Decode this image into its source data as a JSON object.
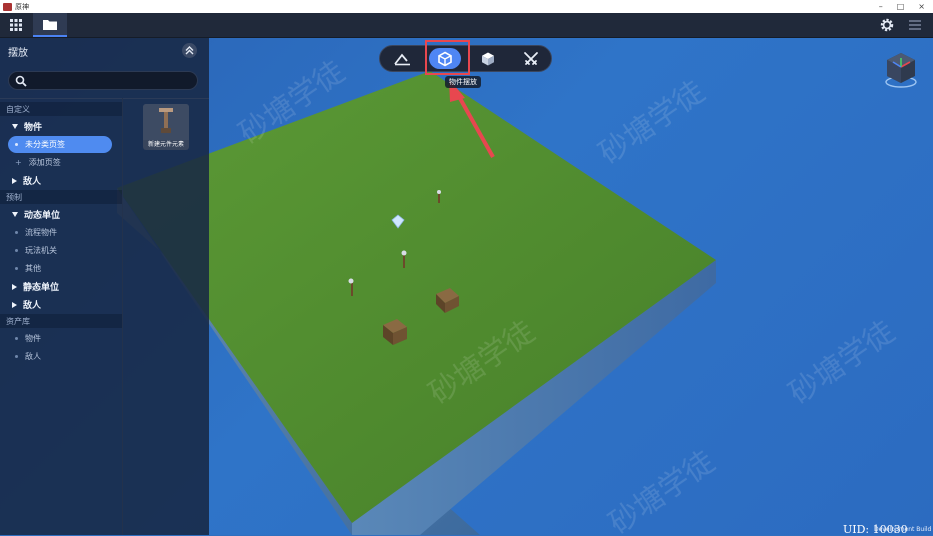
{
  "window": {
    "title": "原神",
    "minimize": "–",
    "maximize": "□",
    "close": "×"
  },
  "toolbar": {
    "grid_icon": "grid-icon",
    "folder_icon": "folder-icon",
    "settings_icon": "gear-icon",
    "menu_icon": "menu-icon"
  },
  "panel": {
    "title": "摆放",
    "search_placeholder": "",
    "tree": [
      {
        "kind": "section",
        "label": "自定义"
      },
      {
        "kind": "group",
        "label": "物件",
        "expanded": true
      },
      {
        "kind": "leaf",
        "label": "未分类页签",
        "active": true
      },
      {
        "kind": "add",
        "label": "添加页签"
      },
      {
        "kind": "group",
        "label": "敌人",
        "expanded": false
      },
      {
        "kind": "section",
        "label": "预制"
      },
      {
        "kind": "group",
        "label": "动态单位",
        "expanded": true
      },
      {
        "kind": "leaf",
        "label": "流程物件"
      },
      {
        "kind": "leaf",
        "label": "玩法机关"
      },
      {
        "kind": "leaf",
        "label": "其他"
      },
      {
        "kind": "group",
        "label": "静态单位",
        "expanded": false
      },
      {
        "kind": "group",
        "label": "敌人",
        "expanded": false
      },
      {
        "kind": "section",
        "label": "资产库"
      },
      {
        "kind": "leaf",
        "label": "物件"
      },
      {
        "kind": "leaf",
        "label": "敌人"
      }
    ],
    "items": [
      {
        "label": "新建元件元素"
      }
    ]
  },
  "modebar": {
    "buttons": [
      {
        "name": "terrain-mode",
        "icon": "terrain-icon",
        "active": false
      },
      {
        "name": "object-place-mode",
        "icon": "cube-outline-icon",
        "active": true
      },
      {
        "name": "block-mode",
        "icon": "cube-solid-icon",
        "active": false
      },
      {
        "name": "combat-mode",
        "icon": "crossed-swords-icon",
        "active": false
      }
    ],
    "tooltip": "物件摆放"
  },
  "status": {
    "uid": "UID: 10030",
    "build": "Development Build"
  },
  "watermark": "砂塘学徒",
  "colors": {
    "accent": "#4f86f4",
    "highlight": "#e8474f",
    "grass": "#4f8f2c",
    "sky": "#2f6fbf"
  }
}
